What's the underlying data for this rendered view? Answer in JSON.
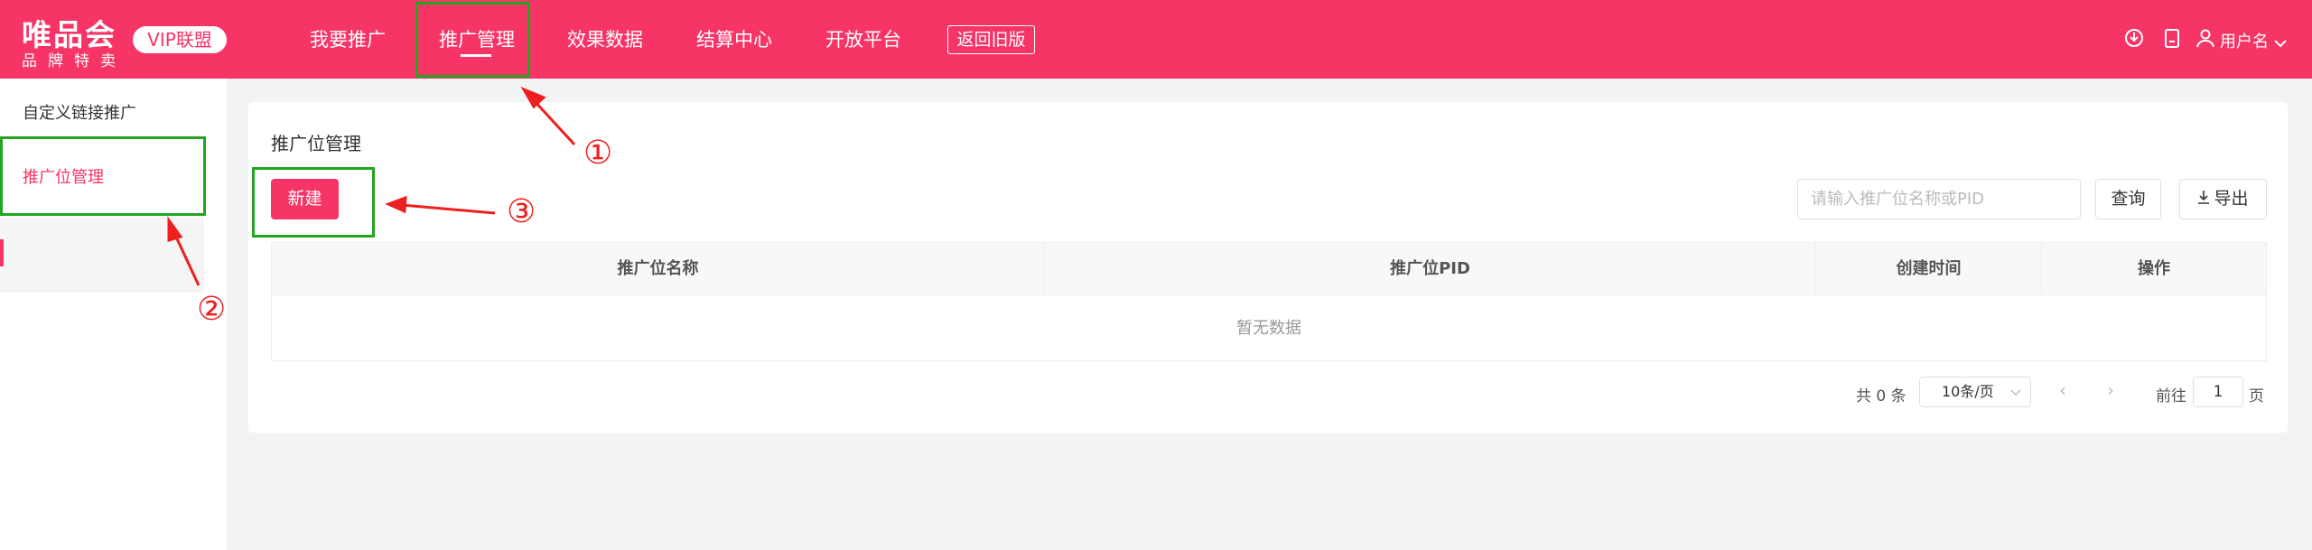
{
  "header": {
    "logo_main": "唯品会",
    "logo_sub": "品牌特卖",
    "vip_badge": "VIP联盟",
    "nav": [
      "我要推广",
      "推广管理",
      "效果数据",
      "结算中心",
      "开放平台"
    ],
    "old_version": "返回旧版",
    "icons": [
      "download-icon",
      "clipboard-icon",
      "user-icon"
    ],
    "username": "用户名"
  },
  "sidebar": {
    "items": [
      "自定义链接推广",
      "推广位管理"
    ]
  },
  "main": {
    "title": "推广位管理",
    "new_button": "新建",
    "search_placeholder": "请输入推广位名称或PID",
    "query_button": "查询",
    "export_button": "导出",
    "table": {
      "columns": [
        "推广位名称",
        "推广位PID",
        "创建时间",
        "操作"
      ],
      "empty_text": "暂无数据"
    },
    "pagination": {
      "total": "共 0 条",
      "page_size": "10条/页",
      "goto": "前往",
      "page": "1",
      "page_unit": "页"
    }
  },
  "annotations": {
    "labels": [
      "①",
      "②",
      "③"
    ],
    "color": "#ee1f1f",
    "box_color": "#22a51f"
  },
  "colors": {
    "brand": "#f73466",
    "background": "#f2f3f5"
  }
}
